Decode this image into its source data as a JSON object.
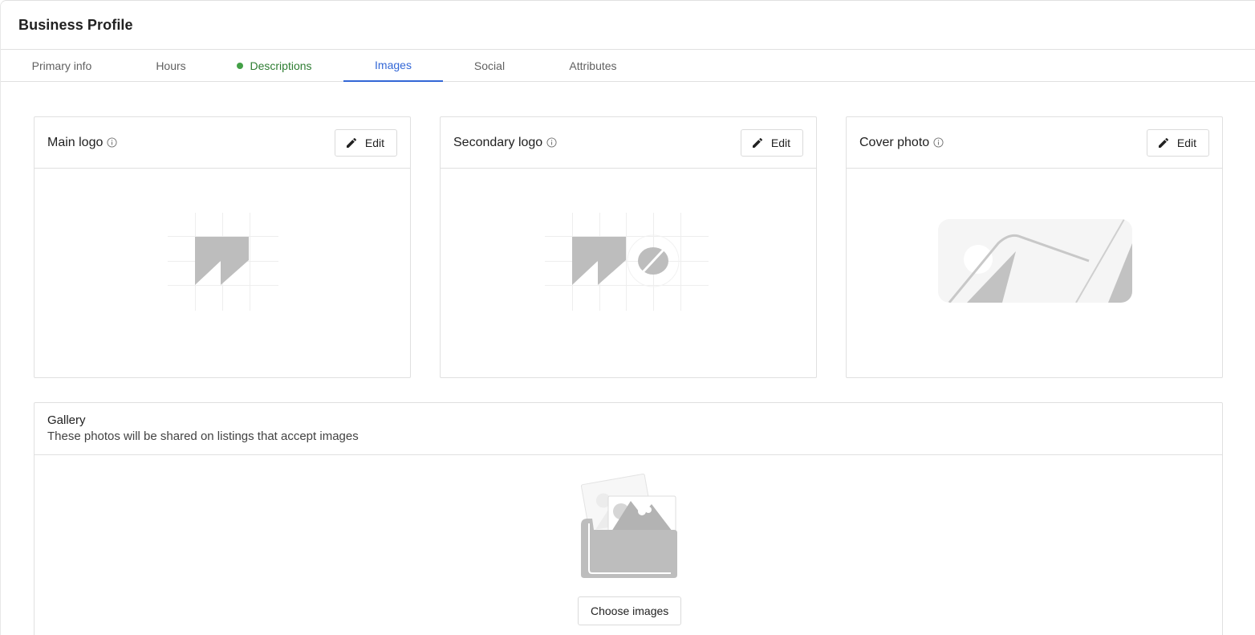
{
  "header": {
    "title": "Business Profile"
  },
  "tabs": [
    {
      "label": "Primary info",
      "state": "default"
    },
    {
      "label": "Hours",
      "state": "default"
    },
    {
      "label": "Descriptions",
      "state": "complete",
      "indicator_color": "#43a047"
    },
    {
      "label": "Images",
      "state": "active"
    },
    {
      "label": "Social",
      "state": "default"
    },
    {
      "label": "Attributes",
      "state": "default"
    }
  ],
  "cards": {
    "main_logo": {
      "title": "Main logo",
      "edit_label": "Edit",
      "info_icon": "info-icon",
      "placeholder": "logo-placeholder-icon"
    },
    "secondary_logo": {
      "title": "Secondary logo",
      "edit_label": "Edit",
      "info_icon": "info-icon",
      "placeholder": "secondary-logo-placeholder-icon"
    },
    "cover_photo": {
      "title": "Cover photo",
      "edit_label": "Edit",
      "info_icon": "info-icon",
      "placeholder": "cover-photo-placeholder-icon"
    }
  },
  "gallery": {
    "title": "Gallery",
    "subtitle": "These photos will be shared on listings that accept images",
    "button_label": "Choose images",
    "placeholder": "photo-folder-icon"
  },
  "colors": {
    "accent": "#3367d6",
    "complete": "#43a047",
    "border": "#e0e0e0",
    "placeholder_gray": "#bdbdbd"
  }
}
